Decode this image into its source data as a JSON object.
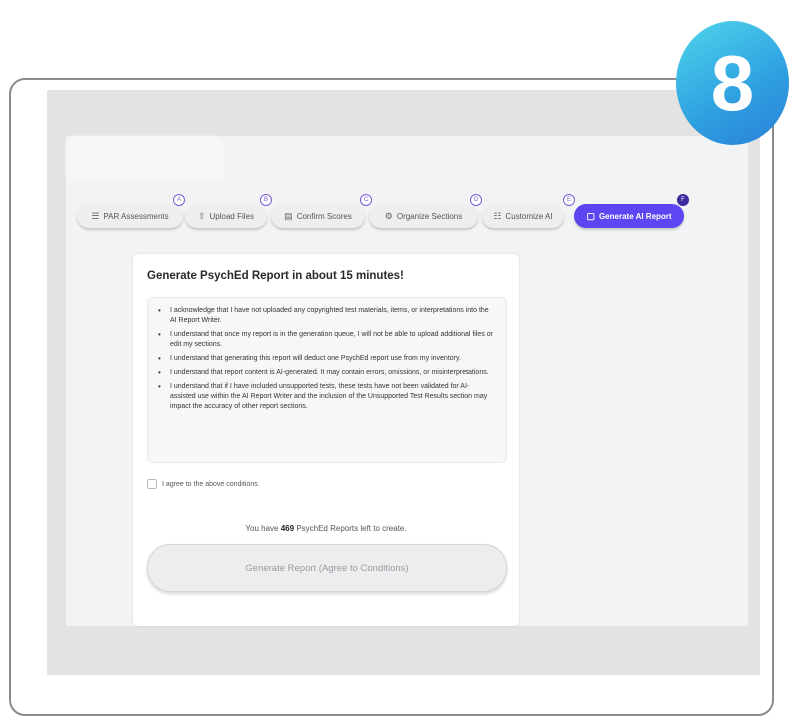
{
  "step_badge": "8",
  "tabs": [
    {
      "label": "PAR Assessments",
      "icon": "list-icon",
      "step": "A"
    },
    {
      "label": "Upload Files",
      "icon": "upload-icon",
      "step": "B"
    },
    {
      "label": "Confirm Scores",
      "icon": "clipboard-icon",
      "step": "C"
    },
    {
      "label": "Organize Sections",
      "icon": "gear-icon",
      "step": "D"
    },
    {
      "label": "Customize AI",
      "icon": "sliders-icon",
      "step": "E"
    },
    {
      "label": "Generate AI Report",
      "icon": "document-icon",
      "step": "F"
    }
  ],
  "card": {
    "title": "Generate PsychEd Report in about 15 minutes!",
    "terms": [
      "I acknowledge that I have not uploaded any copyrighted test materials, items, or interpretations into the AI Report Writer.",
      "I understand that once my report is in the generation queue, I will not be able to upload additional files or edit my sections.",
      "I understand that generating this report will deduct one PsychEd report use from my inventory.",
      "I understand that report content is AI-generated. It may contain errors, omissions, or misinterpretations.",
      "I understand that if I have included unsupported tests, these tests have not been validated for AI-assisted use within the AI Report Writer and the inclusion of the Unsupported Test Results section may impact the accuracy of other report sections."
    ],
    "agree_label": "I agree to the above conditions",
    "remaining_prefix": "You have",
    "remaining_count": "469",
    "remaining_suffix": "PsychEd Reports left to create.",
    "generate_label": "Generate Report (Agree to Conditions)"
  },
  "colors": {
    "accent": "#5b46f2",
    "badge": "#2e9fe0"
  }
}
